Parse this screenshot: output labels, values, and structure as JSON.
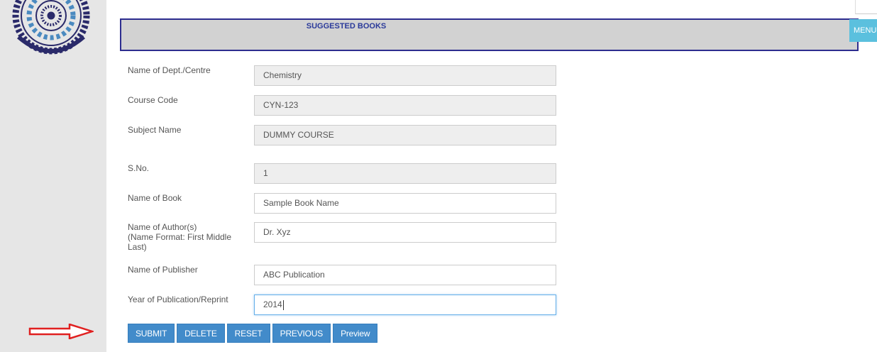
{
  "header": {
    "title": "SUGGESTED BOOKS",
    "menu_label": "MENU"
  },
  "form": {
    "fields": [
      {
        "label": "Name of Dept./Centre",
        "value": "Chemistry"
      },
      {
        "label": "Course Code",
        "value": "CYN-123"
      },
      {
        "label": "Subject Name",
        "value": "DUMMY COURSE"
      },
      {
        "label": "S.No.",
        "value": "1"
      },
      {
        "label": "Name of Book",
        "value": "Sample Book Name"
      },
      {
        "label": "Name of Author(s)\n(Name Format: First Middle\nLast)",
        "value": "Dr. Xyz"
      },
      {
        "label": "Name of Publisher",
        "value": "ABC Publication"
      },
      {
        "label": "Year of Publication/Reprint",
        "value": "2014"
      }
    ]
  },
  "buttons": {
    "submit": "SUBMIT",
    "delete": "DELETE",
    "reset": "RESET",
    "previous": "PREVIOUS",
    "preview": "Preview"
  },
  "colors": {
    "header_border": "#2d2d8f",
    "header_title": "#2a3a9a",
    "button_primary": "#428bca",
    "menu_button": "#5bc0de",
    "arrow": "#e02020"
  },
  "icons": {
    "logo": "institute-emblem-logo",
    "pointer": "red-arrow-right-icon"
  }
}
